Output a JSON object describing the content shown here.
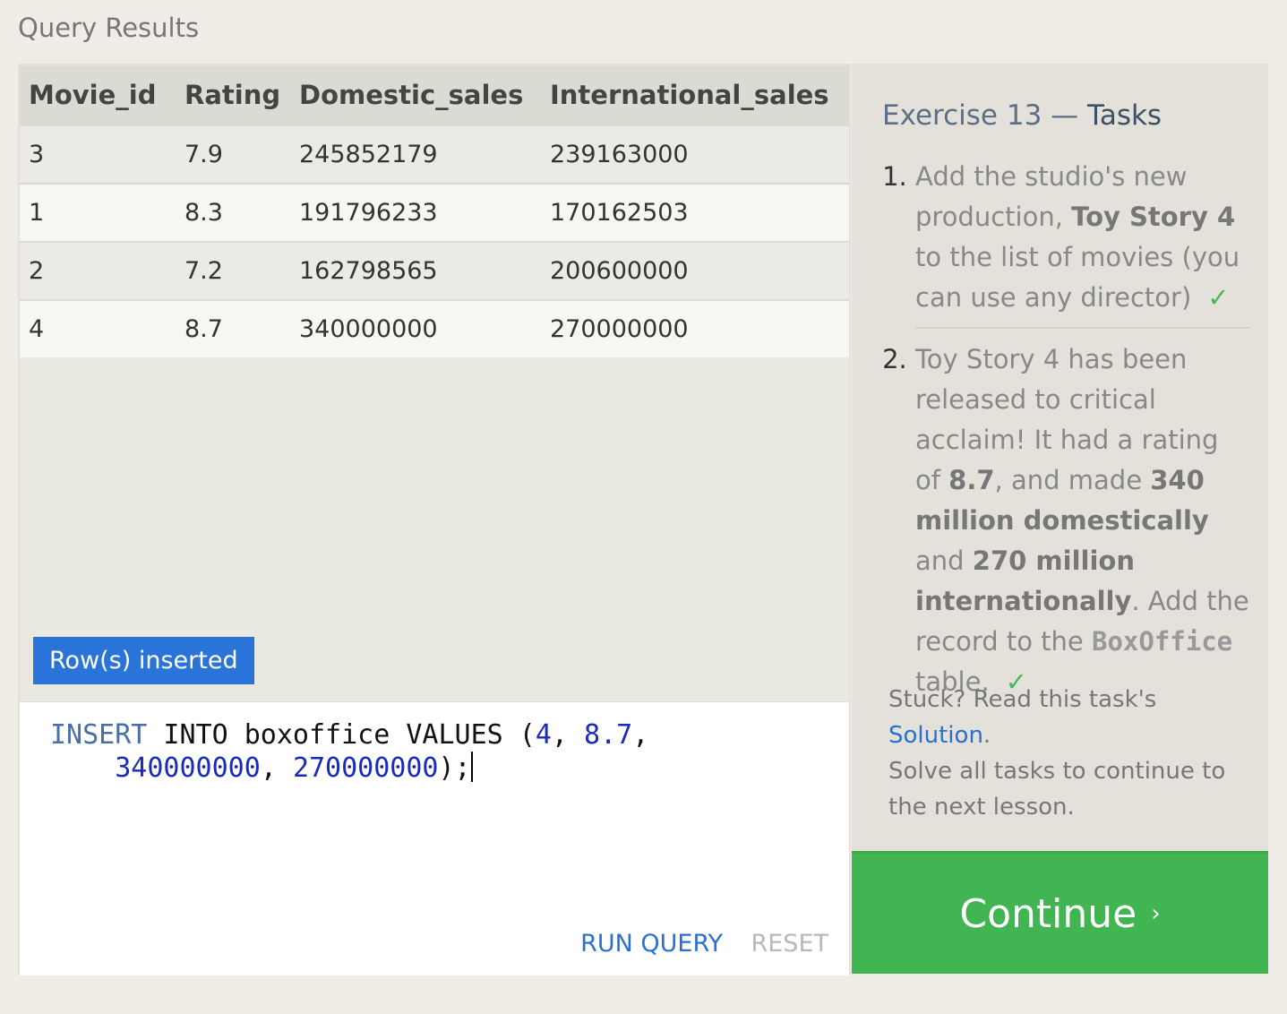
{
  "page": {
    "title": "Query Results"
  },
  "results": {
    "headers": [
      "Movie_id",
      "Rating",
      "Domestic_sales",
      "International_sales"
    ],
    "rows": [
      [
        "3",
        "7.9",
        "245852179",
        "239163000"
      ],
      [
        "1",
        "8.3",
        "191796233",
        "170162503"
      ],
      [
        "2",
        "7.2",
        "162798565",
        "200600000"
      ],
      [
        "4",
        "8.7",
        "340000000",
        "270000000"
      ]
    ],
    "status": "Row(s) inserted"
  },
  "editor": {
    "code_line1": {
      "kw": "INSERT",
      "rest": " INTO boxoffice VALUES (",
      "n1": "4",
      "sep1": ", ",
      "n2": "8.7",
      "sep2": ","
    },
    "code_line2": {
      "indent": "    ",
      "n3": "340000000",
      "sep3": ", ",
      "n4": "270000000",
      "end": ");"
    },
    "run_label": "RUN QUERY",
    "reset_label": "RESET"
  },
  "tasks": {
    "heading_prefix": "Exercise 13 — ",
    "heading_tasks": "Tasks",
    "task1": {
      "t1": "Add the studio's new production, ",
      "b1": "Toy Story 4",
      "t2": " to the list of movies (you can use any director)",
      "check": "✓"
    },
    "task2": {
      "t1": "Toy Story 4 has been released to critical acclaim! It had a rating of ",
      "b1": "8.7",
      "t2": ", and made ",
      "b2": "340 million domestically",
      "t3": " and ",
      "b3": "270 million internationally",
      "t4": ". Add the record to the ",
      "code": "BoxOffice",
      "t5": " table.",
      "check": "✓"
    },
    "stuck_text": "Stuck? Read this task's ",
    "solution_link": "Solution",
    "solution_period": ".",
    "solve_all": "Solve all tasks to continue to the next lesson."
  },
  "continue": {
    "label": "Continue",
    "chevron": "›"
  }
}
